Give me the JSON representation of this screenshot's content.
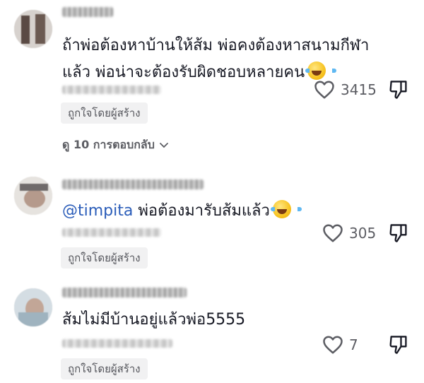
{
  "comments": [
    {
      "text_line1": "ถ้าพ่อต้องหาบ้านให้ส้ม พ่อคงต้องหาสนามกีฬา",
      "text_line2": "แล้ว พ่อน่าจะต้องรับผิดชอบหลายคน",
      "emoji": "face-with-tears-of-joy",
      "like_count": "3415",
      "liked_by_creator": "ถูกใจโดยผู้สร้าง",
      "replies_label": "ดู 10 การตอบกลับ"
    },
    {
      "mention": "@timpita",
      "text": " พ่อต้องมารับส้มแล้ว",
      "emoji": "face-with-tears-of-joy",
      "like_count": "305",
      "liked_by_creator": "ถูกใจโดยผู้สร้าง"
    },
    {
      "text": "ส้มไม่มีบ้านอยู่แล้วพ่อ5555",
      "like_count": "7",
      "liked_by_creator": "ถูกใจโดยผู้สร้าง"
    }
  ],
  "icons": {
    "like": "heart-outline-icon",
    "dislike": "thumbs-down-outline-icon",
    "expand": "chevron-down-icon"
  },
  "colors": {
    "mention": "#2b5db9",
    "text": "#161823",
    "muted": "#5c5d63",
    "badge_bg": "#f1f1f2"
  }
}
